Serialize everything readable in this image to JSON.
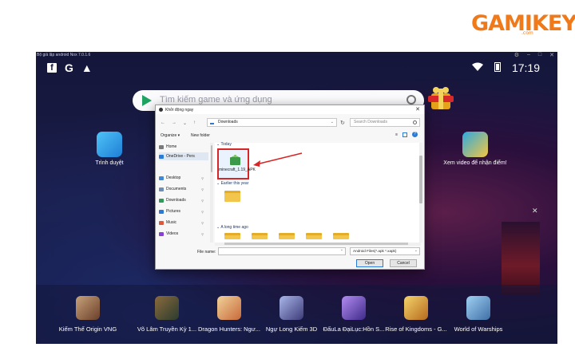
{
  "watermark": {
    "logo": "GAMIKEY",
    "sub": ".com"
  },
  "emulator": {
    "title": "Bộ giả lập android Nox 7.0.1.6",
    "status": {
      "time": "17:19"
    },
    "search": {
      "placeholder": "Tìm kiếm game và ứng dụng"
    },
    "side_apps": [
      {
        "label": "Trình duyệt"
      },
      {
        "label": "Xem video để nhận điểm!"
      }
    ],
    "dock_apps": [
      {
        "label": "Kiếm Thế Origin VNG"
      },
      {
        "label": "Võ Lâm Truyền Kỳ 1..."
      },
      {
        "label": "Dragon Hunters: Ngư..."
      },
      {
        "label": "Ngự Long Kiếm 3D"
      },
      {
        "label": "ĐấuLa ĐạiLục:Hồn S..."
      },
      {
        "label": "Rise of Kingdoms - G..."
      },
      {
        "label": "World of Warships"
      }
    ]
  },
  "dialog": {
    "title": "Khởi động ngay",
    "address": "Downloads",
    "search_placeholder": "Search Downloads",
    "toolbar": {
      "organize": "Organize ▾",
      "new_folder": "New folder"
    },
    "sidebar": [
      {
        "label": "Home"
      },
      {
        "label": "OneDrive - Pers"
      },
      {
        "label": "Desktop"
      },
      {
        "label": "Documents"
      },
      {
        "label": "Downloads"
      },
      {
        "label": "Pictures"
      },
      {
        "label": "Music"
      },
      {
        "label": "Videos"
      }
    ],
    "groups": {
      "today": "Today",
      "earlier": "Earlier this year",
      "long_ago": "A long time ago"
    },
    "selected_file": "minecraft_1.19_APK",
    "file_name_label": "File name:",
    "file_type": "Android Files(*.apk *.xapk)",
    "open_label": "Open",
    "cancel_label": "Cancel"
  },
  "colors": {
    "accent": "#2a7ad6",
    "highlight": "#d62626",
    "watermark": "#f07a1a"
  }
}
